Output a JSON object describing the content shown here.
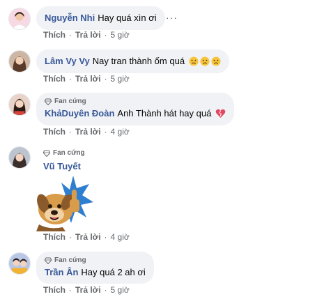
{
  "comments": [
    {
      "author": "Nguyễn Nhi",
      "text": "Hay quá xìn ơi",
      "badge": "",
      "actions": {
        "like": "Thích",
        "reply": "Trả lời",
        "time": "5 giờ"
      }
    },
    {
      "author": "Lâm Vy Vy",
      "text": "Nay tran thành ốm quá",
      "emoji": [
        "sad-face",
        "sad-face",
        "sad-face"
      ],
      "badge": "",
      "actions": {
        "like": "Thích",
        "reply": "Trả lời",
        "time": "5 giờ"
      }
    },
    {
      "author": "KhảDuyên Đoàn",
      "text": "Anh Thành hát hay quá",
      "emoji": [
        "broken-heart"
      ],
      "badge": "Fan cứng",
      "actions": {
        "like": "Thích",
        "reply": "Trả lời",
        "time": "4 giờ"
      }
    },
    {
      "author": "Vũ Tuyết",
      "text": "",
      "sticker": "dog-thumbs-up-sticker",
      "badge": "Fan cứng",
      "actions": {
        "like": "Thích",
        "reply": "Trả lời",
        "time": "4 giờ"
      }
    },
    {
      "author": "Trần Ân",
      "text": "Hay quá 2 ah ơi",
      "badge": "Fan cứng",
      "actions": {
        "like": "Thích",
        "reply": "Trả lời",
        "time": "5 giờ"
      }
    }
  ],
  "more_options_icon": "more-horizontal-icon",
  "colors": {
    "bubble": "#f0f2f5",
    "author": "#385898",
    "text": "#050505",
    "secondary": "#65676b"
  }
}
